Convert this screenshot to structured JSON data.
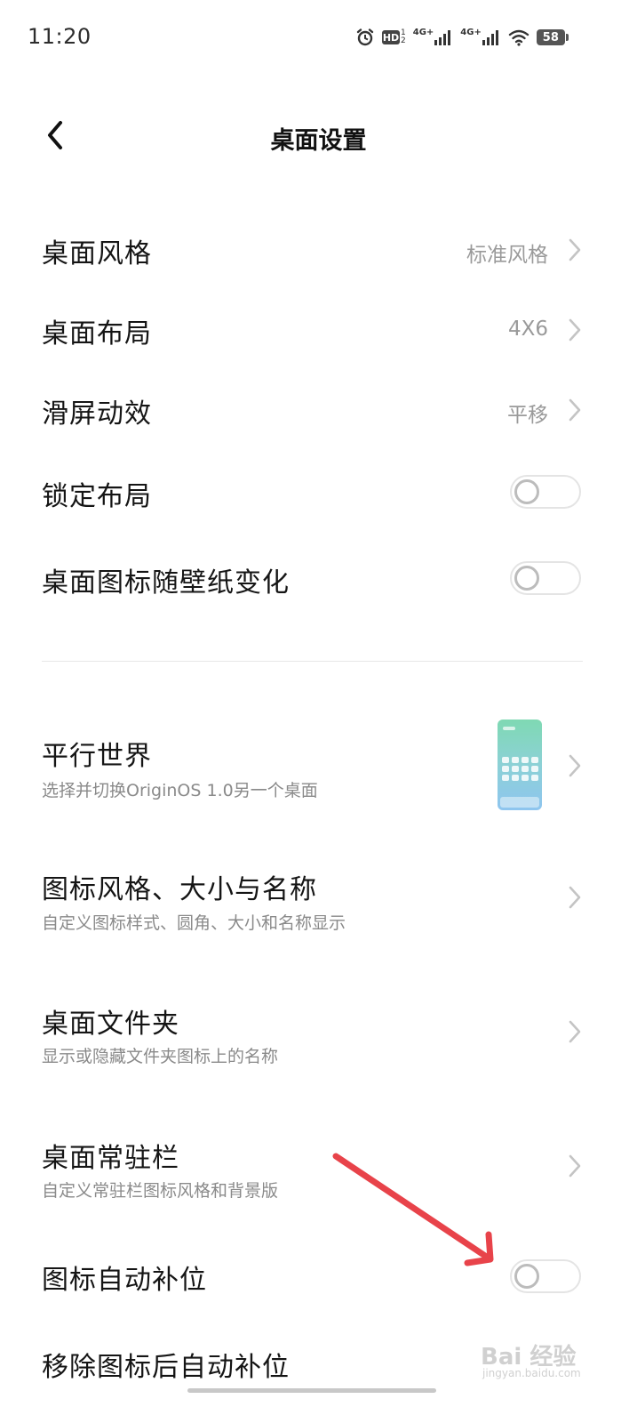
{
  "status_bar": {
    "time": "11:20",
    "hd_label": "HD",
    "hd_sup_top": "1",
    "hd_sup_bottom": "2",
    "net1_label": "4G+",
    "net2_label": "4G+",
    "battery_level": "58",
    "icons": [
      "alarm-icon",
      "hd-icon",
      "signal-icon",
      "signal-icon",
      "wifi-icon",
      "battery-icon"
    ]
  },
  "header": {
    "title": "桌面设置",
    "back_icon": "chevron-left-icon"
  },
  "settings": {
    "desktop_style": {
      "label": "桌面风格",
      "value": "标准风格"
    },
    "desktop_layout": {
      "label": "桌面布局",
      "value": "4X6"
    },
    "scroll_effect": {
      "label": "滑屏动效",
      "value": "平移"
    },
    "lock_layout": {
      "label": "锁定布局",
      "enabled": false
    },
    "icons_follow_wallpaper": {
      "label": "桌面图标随壁纸变化",
      "enabled": false
    },
    "parallel_world": {
      "label": "平行世界",
      "subtitle": "选择并切换OriginOS 1.0另一个桌面"
    },
    "icon_style": {
      "label": "图标风格、大小与名称",
      "subtitle": "自定义图标样式、圆角、大小和名称显示"
    },
    "desktop_folder": {
      "label": "桌面文件夹",
      "subtitle": "显示或隐藏文件夹图标上的名称"
    },
    "dock_bar": {
      "label": "桌面常驻栏",
      "subtitle": "自定义常驻栏图标风格和背景版"
    },
    "auto_fill": {
      "label": "图标自动补位",
      "enabled": false
    },
    "remove_auto_fill": {
      "label": "移除图标后自动补位"
    }
  },
  "watermark": {
    "text": "Bai 经验",
    "sub": "jingyan.baidu.com"
  },
  "colors": {
    "annotation_arrow": "#e8434a",
    "toggle_border": "#e4e4e4",
    "secondary_text": "#8a8a8a"
  }
}
